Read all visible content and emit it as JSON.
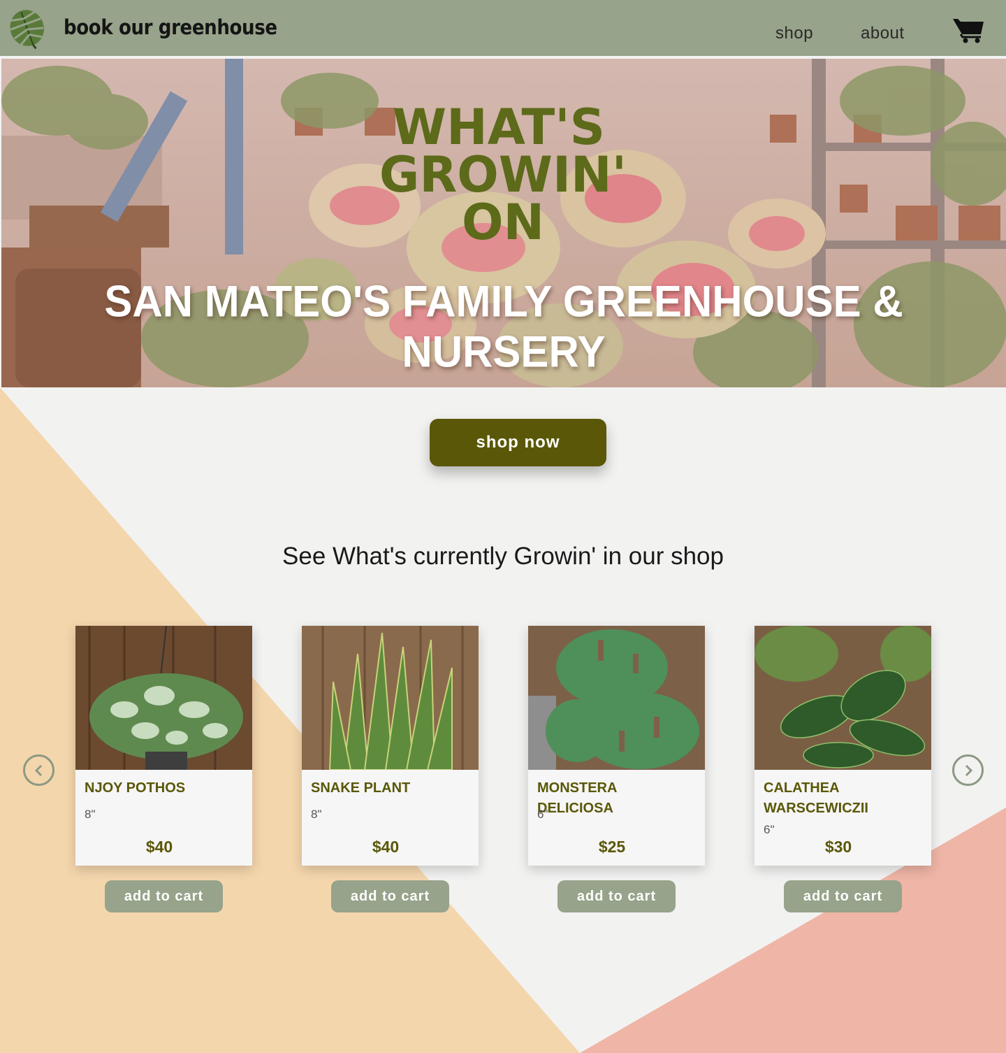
{
  "header": {
    "brand": "book our greenhouse",
    "logo_icon": "monstera-leaf-icon",
    "nav": {
      "shop": "shop",
      "about": "about"
    },
    "cart_icon": "cart-icon",
    "background": "#97a38a"
  },
  "hero": {
    "logo_text_line1": "WHAT'S",
    "logo_text_line2": "GROWIN'",
    "logo_text_line3": "ON",
    "title": "SAN MATEO'S FAMILY GREENHOUSE & NURSERY"
  },
  "cta": {
    "shop_now": "shop now"
  },
  "section": {
    "heading": "See What's currently Growin' in our shop"
  },
  "carousel": {
    "prev_icon": "chevron-left-icon",
    "next_icon": "chevron-right-icon",
    "products": [
      {
        "name": "NJOY POTHOS",
        "size": "8\"",
        "price": "$40",
        "button": "add to cart"
      },
      {
        "name": "SNAKE PLANT",
        "size": "8\"",
        "price": "$40",
        "button": "add to cart"
      },
      {
        "name": "MONSTERA DELICIOSA",
        "size": "6\"",
        "price": "$25",
        "button": "add to cart"
      },
      {
        "name": "CALATHEA WARSCEWICZII",
        "size": "6\"",
        "price": "$30",
        "button": "add to cart"
      }
    ]
  },
  "colors": {
    "olive": "#5a5708",
    "sage": "#97a38a",
    "peach": "#f4d6ad",
    "pink": "#efb5a6",
    "background": "#f2f2f1"
  }
}
